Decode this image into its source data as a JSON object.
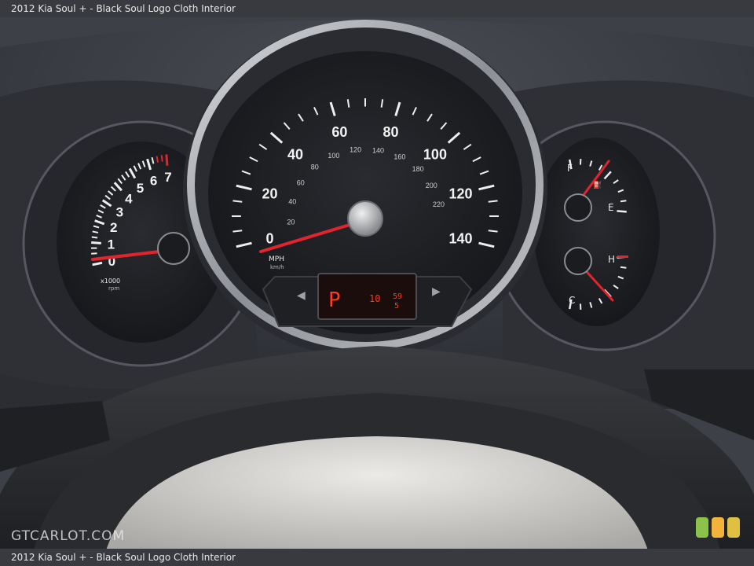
{
  "caption": {
    "top": "2012 Kia Soul + - Black Soul Logo Cloth Interior",
    "bottom": "2012 Kia Soul + - Black Soul Logo Cloth Interior"
  },
  "watermark": "GTCARLOT.COM",
  "badges": [
    "#8bc34a",
    "#f2b23c",
    "#e0c040"
  ],
  "speedometer": {
    "mph_labels": [
      "0",
      "20",
      "40",
      "60",
      "80",
      "100",
      "120",
      "140"
    ],
    "kmh_labels": [
      "20",
      "40",
      "60",
      "80",
      "100",
      "120",
      "140",
      "160",
      "180",
      "200",
      "220"
    ],
    "unit_mph": "MPH",
    "unit_kmh": "km/h",
    "reading_mph": 0
  },
  "tachometer": {
    "labels": [
      "0",
      "1",
      "2",
      "3",
      "4",
      "5",
      "6",
      "7"
    ],
    "unit": "x1000",
    "unit2": "rpm"
  },
  "fuel_gauge": {
    "full": "F",
    "empty": "E"
  },
  "temp_gauge": {
    "hot": "H",
    "cold": "C"
  },
  "display": {
    "gear": "P",
    "value_a": "10",
    "value_b": "59",
    "value_c": "5"
  },
  "colors": {
    "needle": "#e2242e",
    "lcd": "#ff3a1e",
    "dial": "#1c1d21"
  }
}
